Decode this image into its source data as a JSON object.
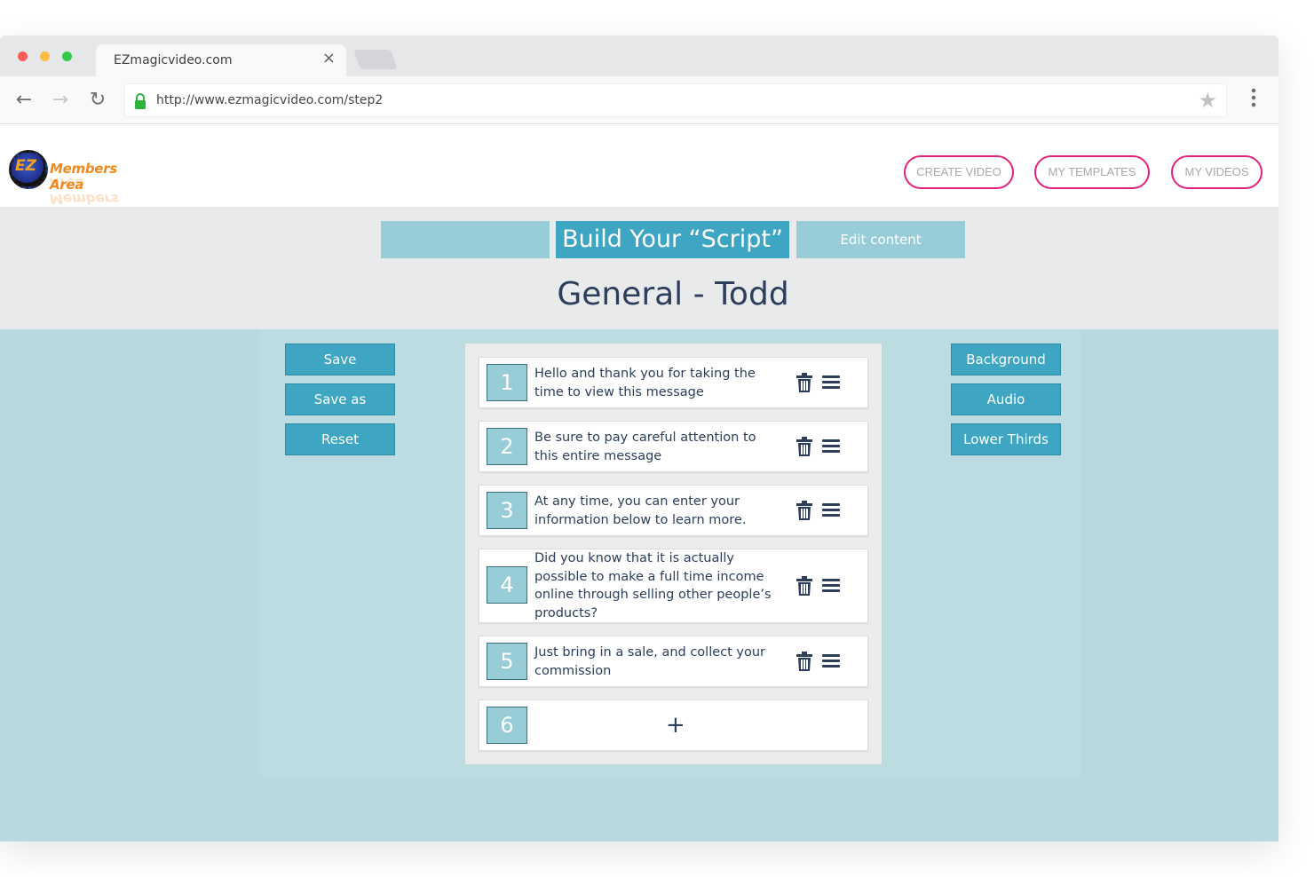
{
  "browser": {
    "tab_title": "EZmagicvideo.com",
    "tab_close": "×",
    "url": "http://www.ezmagicvideo.com/step2",
    "back_icon": "←",
    "forward_icon": "→",
    "reload_icon": "↻",
    "star_icon": "★",
    "menu_icon": "⋮"
  },
  "header": {
    "logo_ez": "EZ",
    "logo_text": "Members Area",
    "nav": [
      "CREATE VIDEO",
      "MY TEMPLATES",
      "MY VIDEOS"
    ]
  },
  "steps": {
    "step1": "",
    "step2": "Build Your “Script”",
    "step3": "Edit content"
  },
  "page_title": "General - Todd",
  "left_buttons": [
    "Save",
    "Save as",
    "Reset"
  ],
  "right_buttons": [
    "Background",
    "Audio",
    "Lower Thirds"
  ],
  "script_items": [
    {
      "num": "1",
      "text": "Hello and thank you for taking the time to view this message"
    },
    {
      "num": "2",
      "text": "Be sure to pay careful attention to this entire message"
    },
    {
      "num": "3",
      "text": "At any time, you can enter your information below to learn more."
    },
    {
      "num": "4",
      "text": "Did you know that it is actually possible to make a full time income online through selling other people’s products?"
    },
    {
      "num": "5",
      "text": "Just bring in a sale, and collect your commission"
    }
  ],
  "add_item": {
    "num": "6",
    "plus": "+"
  },
  "colors": {
    "accent": "#3ea6c2",
    "accent_light": "#98cdd8",
    "pill_border": "#e2237e",
    "workspace_bg": "#b8d9df",
    "text_dark": "#2c3e5c"
  }
}
